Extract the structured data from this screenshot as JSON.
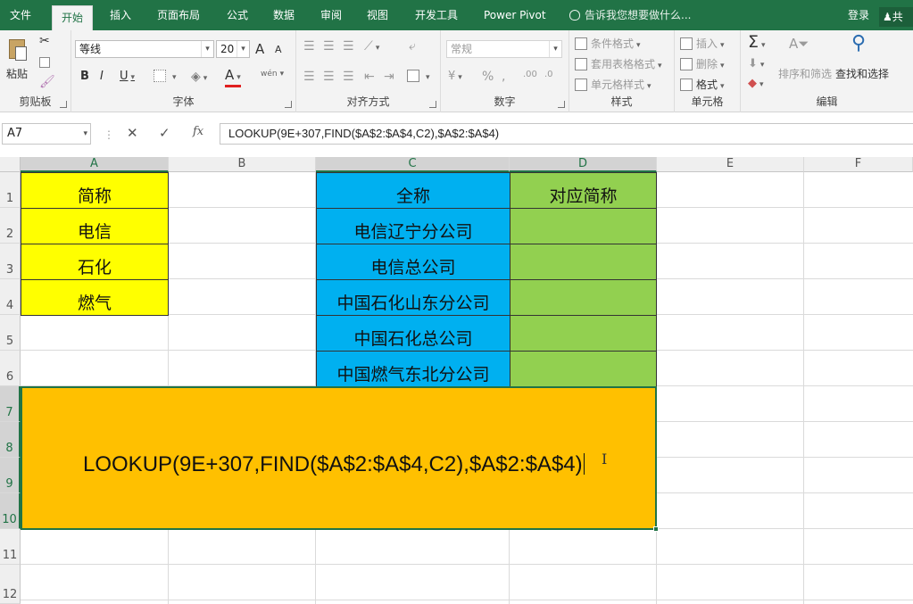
{
  "tabs": [
    {
      "label": "文件"
    },
    {
      "label": "开始"
    },
    {
      "label": "插入"
    },
    {
      "label": "页面布局"
    },
    {
      "label": "公式"
    },
    {
      "label": "数据"
    },
    {
      "label": "审阅"
    },
    {
      "label": "视图"
    },
    {
      "label": "开发工具"
    },
    {
      "label": "Power Pivot"
    }
  ],
  "tell_me": "告诉我您想要做什么...",
  "login": "登录",
  "share": "共",
  "ribbon": {
    "clipboard": {
      "label": "剪贴板",
      "paste": "粘贴"
    },
    "font": {
      "label": "字体",
      "name": "等线",
      "size": "20",
      "bold": "B",
      "italic": "I",
      "underline": "U",
      "grow": "A",
      "shrink": "A",
      "font_color": "A",
      "phonetic": "wén"
    },
    "alignment": {
      "label": "对齐方式"
    },
    "number": {
      "label": "数字",
      "format": "常规",
      "percent": "%",
      "comma": ","
    },
    "styles": {
      "label": "样式",
      "conditional": "条件格式",
      "table": "套用表格格式",
      "cell_styles": "单元格样式"
    },
    "cells": {
      "label": "单元格",
      "insert": "插入",
      "delete": "删除",
      "format": "格式"
    },
    "editing": {
      "label": "编辑",
      "sort_filter": "排序和筛选",
      "find_select": "查找和选择",
      "sigma": "Σ"
    }
  },
  "formula_bar": {
    "name_box": "A7",
    "cancel": "✕",
    "confirm": "✓",
    "fx": "fx",
    "formula": "LOOKUP(9E+307,FIND($A$2:$A$4,C2),$A$2:$A$4)"
  },
  "columns": [
    "A",
    "B",
    "C",
    "D",
    "E",
    "F"
  ],
  "rows": [
    "1",
    "2",
    "3",
    "4",
    "5",
    "6",
    "7",
    "8",
    "9",
    "10",
    "11",
    "12"
  ],
  "cells": {
    "A1": "简称",
    "A2": "电信",
    "A3": "石化",
    "A4": "燃气",
    "C1": "全称",
    "C2": "电信辽宁分公司",
    "C3": "电信总公司",
    "C4": "中国石化山东分公司",
    "C5": "中国石化总公司",
    "C6": "中国燃气东北分公司",
    "D1": "对应简称"
  },
  "merged_text": "LOOKUP(9E+307,FIND($A$2:$A$4,C2),$A$2:$A$4)",
  "colors": {
    "excel_green": "#217346",
    "yellow": "#ffff00",
    "blue": "#00b0f0",
    "green": "#92d050",
    "orange": "#ffc000"
  }
}
